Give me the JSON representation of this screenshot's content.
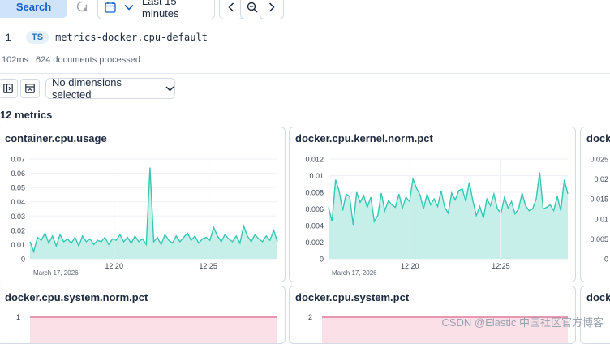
{
  "toolbar": {
    "search_label": "Search",
    "time_range": "Last 15 minutes"
  },
  "query": {
    "line_number": "1",
    "badge": "TS",
    "text": "metrics-docker.cpu-default"
  },
  "stats": {
    "duration": "102ms",
    "documents": "624 documents processed"
  },
  "breakdown": {
    "dimensions_label": "No dimensions selected"
  },
  "metrics_count_label": "12 metrics",
  "colors": {
    "teal": "#35c7b4",
    "teal_fill": "#c7efe9",
    "pink": "#e3799a",
    "pink_fill": "#fbe0e8",
    "accent": "#1a5fc4"
  },
  "icons": [
    "calendar-icon",
    "chevron-down-icon",
    "chevron-left-icon",
    "chevron-right-icon",
    "zoom-out-icon",
    "refresh-icon",
    "layout-icon",
    "panel-icon"
  ],
  "cards": [
    {
      "title": "container.cpu.usage",
      "date_label": "March 17, 2026"
    },
    {
      "title": "docker.cpu.kernel.norm.pct",
      "date_label": "March 17, 2026"
    },
    {
      "title": "docke"
    },
    {
      "title": "docker.cpu.system.norm.pct"
    },
    {
      "title": "docker.cpu.system.pct"
    },
    {
      "title": "docke"
    }
  ],
  "chart_data": [
    {
      "type": "area",
      "title": "container.cpu.usage",
      "yticks": [
        "0.07",
        "0.06",
        "0.05",
        "0.04",
        "0.03",
        "0.02",
        "0.01",
        "0"
      ],
      "xticks": [
        "12:20",
        "12:25"
      ],
      "ylim": [
        0,
        0.07
      ],
      "values": [
        0.012,
        0.005,
        0.015,
        0.013,
        0.018,
        0.011,
        0.016,
        0.009,
        0.017,
        0.012,
        0.014,
        0.011,
        0.015,
        0.009,
        0.016,
        0.012,
        0.014,
        0.01,
        0.013,
        0.012,
        0.015,
        0.01,
        0.014,
        0.013,
        0.017,
        0.012,
        0.015,
        0.011,
        0.016,
        0.012,
        0.014,
        0.01,
        0.064,
        0.012,
        0.015,
        0.01,
        0.017,
        0.013,
        0.011,
        0.016,
        0.012,
        0.015,
        0.018,
        0.013,
        0.016,
        0.011,
        0.014,
        0.015,
        0.013,
        0.022,
        0.016,
        0.012,
        0.017,
        0.014,
        0.012,
        0.016,
        0.011,
        0.023,
        0.016,
        0.012,
        0.017,
        0.014,
        0.012,
        0.016,
        0.013,
        0.02,
        0.012
      ]
    },
    {
      "type": "area",
      "title": "docker.cpu.kernel.norm.pct",
      "yticks": [
        "0.012",
        "0.01",
        "0.008",
        "0.006",
        "0.004",
        "0.002",
        "0"
      ],
      "xticks": [
        "12:20",
        "12:25"
      ],
      "ylim": [
        0,
        0.012
      ],
      "values": [
        0.0062,
        0.0045,
        0.0095,
        0.0082,
        0.0058,
        0.0078,
        0.0075,
        0.0041,
        0.008,
        0.0068,
        0.0076,
        0.0062,
        0.0074,
        0.0045,
        0.0052,
        0.0079,
        0.0058,
        0.007,
        0.0065,
        0.0062,
        0.0078,
        0.0061,
        0.0074,
        0.0069,
        0.0096,
        0.0085,
        0.0077,
        0.006,
        0.0078,
        0.0065,
        0.0072,
        0.0063,
        0.0082,
        0.0062,
        0.0055,
        0.0079,
        0.0071,
        0.0082,
        0.0084,
        0.0069,
        0.0092,
        0.007,
        0.0052,
        0.0063,
        0.0049,
        0.0072,
        0.0064,
        0.0078,
        0.006,
        0.0055,
        0.0074,
        0.0061,
        0.0069,
        0.0054,
        0.006,
        0.0079,
        0.0064,
        0.0058,
        0.006,
        0.0072,
        0.0104,
        0.006,
        0.0062,
        0.0065,
        0.0058,
        0.0075,
        0.0058,
        0.0095,
        0.0078
      ]
    },
    {
      "type": "area",
      "title": "docke",
      "yticks": [
        "0.025",
        "0.02",
        "0.015",
        "0.01",
        "0.005",
        "0"
      ]
    },
    {
      "type": "area",
      "title": "docker.cpu.system.norm.pct",
      "yticks": [
        "1"
      ]
    },
    {
      "type": "area",
      "title": "docker.cpu.system.pct",
      "yticks": [
        "2"
      ]
    }
  ],
  "watermark": "CSDN @Elastic 中国社区官方博客"
}
